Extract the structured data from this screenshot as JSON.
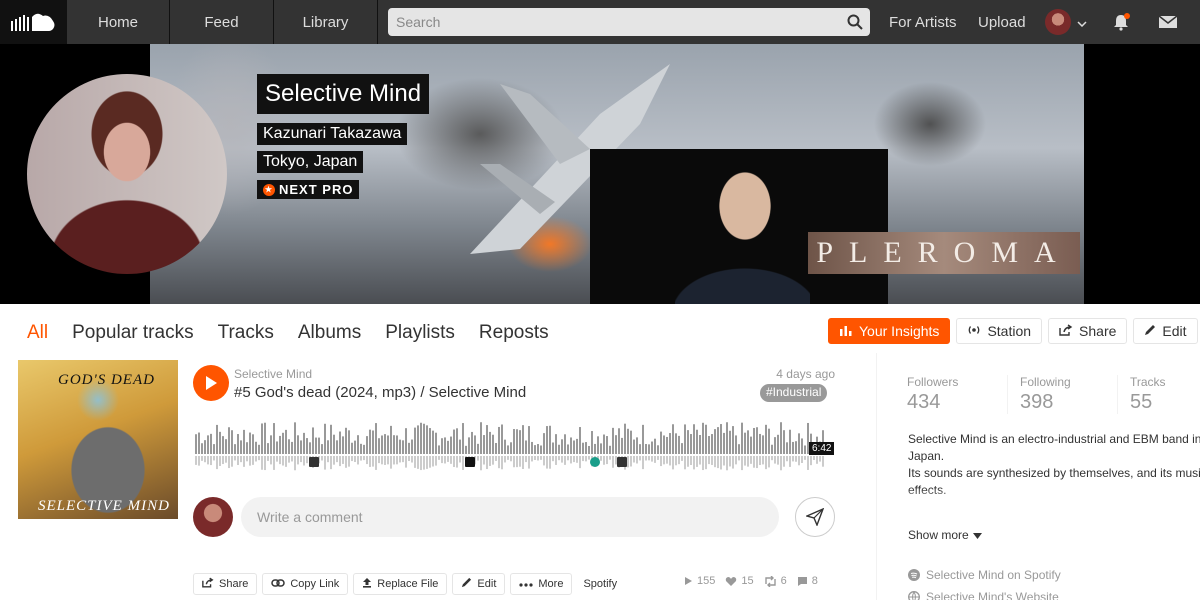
{
  "nav": {
    "home": "Home",
    "feed": "Feed",
    "library": "Library",
    "search_placeholder": "Search",
    "for_artists": "For Artists",
    "upload": "Upload"
  },
  "profile": {
    "name": "Selective Mind",
    "real_name": "Kazunari Takazawa",
    "location": "Tokyo, Japan",
    "pro_badge": "NEXT PRO",
    "banner_text": "PLEROMA"
  },
  "tabs": [
    "All",
    "Popular tracks",
    "Tracks",
    "Albums",
    "Playlists",
    "Reposts"
  ],
  "actions": {
    "insights": "Your Insights",
    "station": "Station",
    "share": "Share",
    "edit": "Edit"
  },
  "track": {
    "artwork_title": "GOD'S DEAD",
    "artwork_name": "SELECTIVE MIND",
    "user": "Selective Mind",
    "title": "#5 God's dead (2024, mp3) / Selective Mind",
    "date": "4 days ago",
    "genre": "#Industrial",
    "duration": "6:42",
    "comment_placeholder": "Write a comment",
    "buttons": {
      "share": "Share",
      "copy_link": "Copy Link",
      "replace_file": "Replace File",
      "edit": "Edit",
      "more": "More",
      "spotify": "Spotify"
    },
    "stats": {
      "plays": "155",
      "likes": "15",
      "reposts": "6",
      "comments": "8"
    }
  },
  "sidebar": {
    "followers_label": "Followers",
    "followers": "434",
    "following_label": "Following",
    "following": "398",
    "tracks_label": "Tracks",
    "tracks": "55",
    "bio_line1": "Selective Mind is an electro-industrial and EBM band in Japan.",
    "bio_line2": "Its sounds are synthesized by themselves, and its music has hardly preset sounds except some sound",
    "bio_line3": "effects.",
    "show_more": "Show more",
    "link_spotify": "Selective Mind on Spotify",
    "link_website": "Selective Mind's Website"
  },
  "colors": {
    "accent": "#ff5500",
    "nav_bg": "#333333"
  }
}
